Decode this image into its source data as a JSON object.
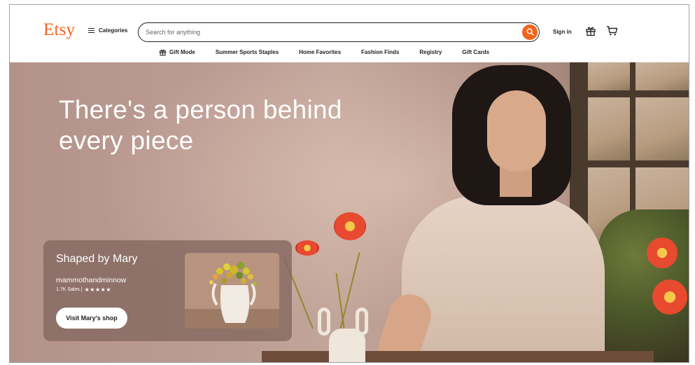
{
  "header": {
    "logo": "Etsy",
    "categories_label": "Categories",
    "search_placeholder": "Search for anything",
    "signin_label": "Sign in"
  },
  "subnav": {
    "items": [
      {
        "label": "Gift Mode",
        "icon": "gift-icon"
      },
      {
        "label": "Summer Sports Staples"
      },
      {
        "label": "Home Favorites"
      },
      {
        "label": "Fashion Finds"
      },
      {
        "label": "Registry"
      },
      {
        "label": "Gift Cards"
      }
    ]
  },
  "hero": {
    "title": "There's a person behind every piece",
    "card": {
      "title": "Shaped by Mary",
      "shop_name": "mammothandminnow",
      "sales": "1.7K Sales |",
      "stars": "★★★★★",
      "rating_stars": 5,
      "button_label": "Visit Mary's shop"
    }
  },
  "colors": {
    "brand": "#f1641e",
    "card_bg": "#856960",
    "text_dark": "#222222"
  }
}
